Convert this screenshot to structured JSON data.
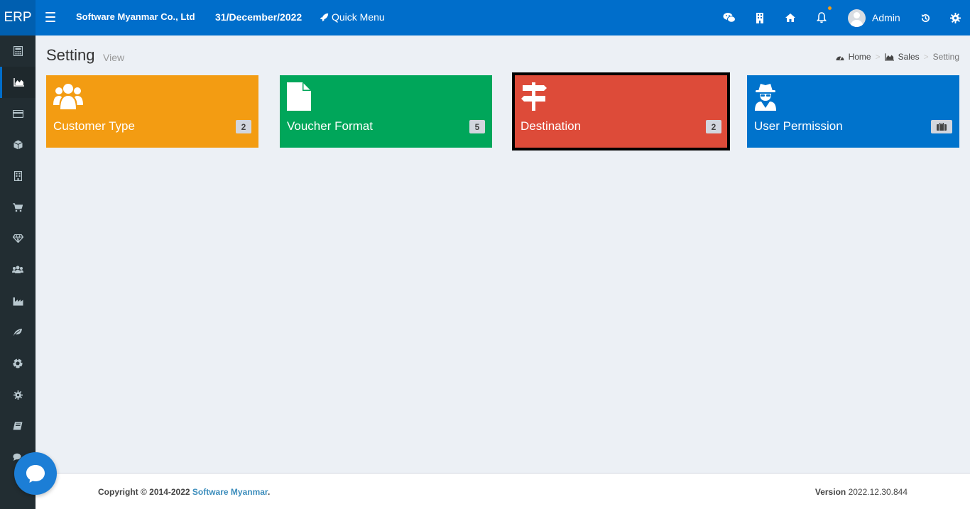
{
  "header": {
    "logo": "ERP",
    "company": "Software Myanmar Co., Ltd",
    "date": "31/December/2022",
    "quick_menu": "Quick Menu",
    "username": "Admin",
    "icons": [
      "wechat-icon",
      "building-icon",
      "home-icon",
      "bell-icon",
      "history-icon",
      "gear-icon"
    ]
  },
  "sidebar": {
    "items": [
      {
        "icon": "calculator-icon"
      },
      {
        "icon": "area-chart-icon",
        "active": true
      },
      {
        "icon": "credit-card-icon"
      },
      {
        "icon": "cube-icon"
      },
      {
        "icon": "building-icon"
      },
      {
        "icon": "cart-icon"
      },
      {
        "icon": "diamond-icon"
      },
      {
        "icon": "users-icon"
      },
      {
        "icon": "industry-icon"
      },
      {
        "icon": "leaf-icon"
      },
      {
        "icon": "soccer-ball-icon"
      },
      {
        "icon": "gear-icon"
      },
      {
        "icon": "book-icon"
      },
      {
        "icon": "comments-icon"
      }
    ]
  },
  "page": {
    "title": "Setting",
    "subtitle": "View"
  },
  "breadcrumb": {
    "home": "Home",
    "sales": "Sales",
    "current": "Setting",
    "separator": ">"
  },
  "tiles": [
    {
      "label": "Customer Type",
      "count": "2",
      "color": "#f39c12",
      "icon": "users-icon"
    },
    {
      "label": "Voucher Format",
      "count": "5",
      "color": "#00a65a",
      "icon": "file-icon"
    },
    {
      "label": "Destination",
      "count": "2",
      "color": "#dd4b39",
      "icon": "signpost-icon"
    },
    {
      "label": "User Permission",
      "count": "",
      "color": "#0073cc",
      "icon": "user-secret-icon",
      "badge_icon": "briefcase-icon"
    }
  ],
  "footer": {
    "copyright_prefix": "Copyright © 2014-2022 ",
    "copyright_link": "Software Myanmar",
    "copyright_suffix": ".",
    "version_label": "Version",
    "version_value": "2022.12.30.844"
  },
  "colors": {
    "header": "#006ecb",
    "sidebar": "#222d32",
    "background": "#ecf0f5"
  }
}
